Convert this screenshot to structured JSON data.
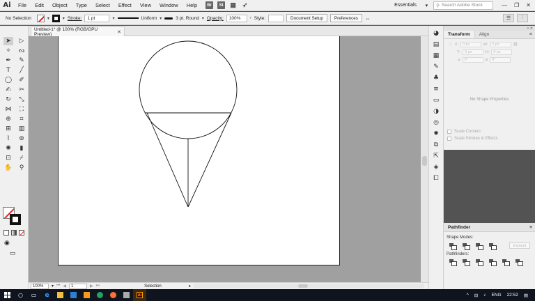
{
  "app": {
    "logo": "Ai",
    "menus": [
      "File",
      "Edit",
      "Object",
      "Type",
      "Select",
      "Effect",
      "View",
      "Window",
      "Help"
    ],
    "menu_icons": [
      "Br",
      "St"
    ],
    "workspace": "Essentials",
    "search_placeholder": "Search Adobe Stock"
  },
  "control": {
    "selection": "No Selection",
    "stroke_label": "Stroke:",
    "stroke_weight": "1 pt",
    "profile": "Uniform",
    "brush": "3 pt. Round",
    "opacity_label": "Opacity:",
    "opacity": "100%",
    "style_label": "Style:",
    "document_setup": "Document Setup",
    "preferences": "Preferences"
  },
  "document": {
    "tab_title": "Untitled-1* @ 100% (RGB/GPU Preview)"
  },
  "status": {
    "zoom": "100%",
    "page": "1",
    "tool": "Selection"
  },
  "transform_panel": {
    "tabs": [
      "Transform",
      "Align"
    ],
    "x_label": "X:",
    "y_label": "Y:",
    "w_label": "W:",
    "h_label": "H:",
    "x_value": "0 px",
    "y_value": "0 px",
    "w_value": "0 px",
    "h_value": "0 px",
    "angle_value": "0°",
    "shear_value": "0°",
    "no_shape": "No Shape Properties",
    "scale_corners": "Scale Corners",
    "scale_strokes": "Scale Strokes & Effects"
  },
  "pathfinder_panel": {
    "title": "Pathfinder",
    "shape_modes": "Shape Modes:",
    "pathfinders": "Pathfinders:",
    "expand": "Expand"
  },
  "taskbar": {
    "lang": "ENG",
    "time": "22:52"
  },
  "colors": {
    "accent_red": "#e02020",
    "canvas_gray": "#a0a0a0",
    "taskbar": "#10141f"
  }
}
